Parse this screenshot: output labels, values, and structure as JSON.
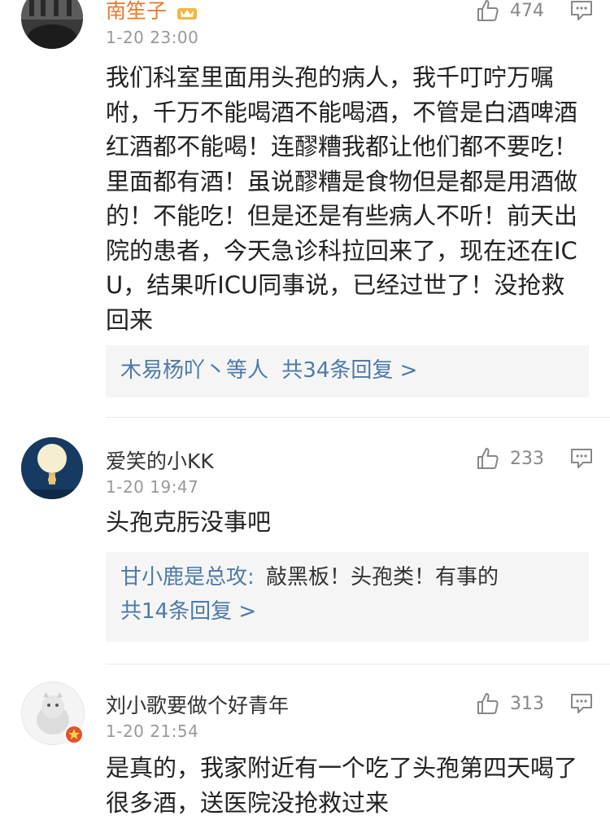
{
  "comments": [
    {
      "username": "南笙子",
      "time": "1-20 23:00",
      "likes": "474",
      "text": "我们科室里面用头孢的病人，我千叮咛万嘱咐，千万不能喝酒不能喝酒，不管是白酒啤酒红酒都不能喝！连醪糟我都让他们都不要吃！里面都有酒！虽说醪糟是食物但是都是用酒做的！不能吃！但是还是有些病人不听！前天出院的患者，今天急诊科拉回来了，现在还在ICU，结果听ICU同事说，已经过世了！没抢救回来",
      "reply_users": "木易杨吖丶等人",
      "reply_count": "共34条回复 >"
    },
    {
      "username": "爱笑的小KK",
      "time": "1-20 19:47",
      "likes": "233",
      "text": "头孢克肟没事吧",
      "reply_user": "甘小鹿是总攻:",
      "reply_text": "敲黑板！头孢类！有事的",
      "reply_count": "共14条回复 >"
    },
    {
      "username": "刘小歌要做个好青年",
      "time": "1-20 21:54",
      "likes": "313",
      "text": "是真的，我家附近有一个吃了头孢第四天喝了很多酒，送医院没抢救过来"
    }
  ],
  "icons": {
    "like": "thumbs-up-icon",
    "reply": "comment-icon",
    "vip": "crown-badge-icon",
    "verified": "star-badge-icon"
  },
  "colors": {
    "link": "#4d7aa8",
    "username_vip": "#e8792e",
    "meta": "#999999"
  }
}
